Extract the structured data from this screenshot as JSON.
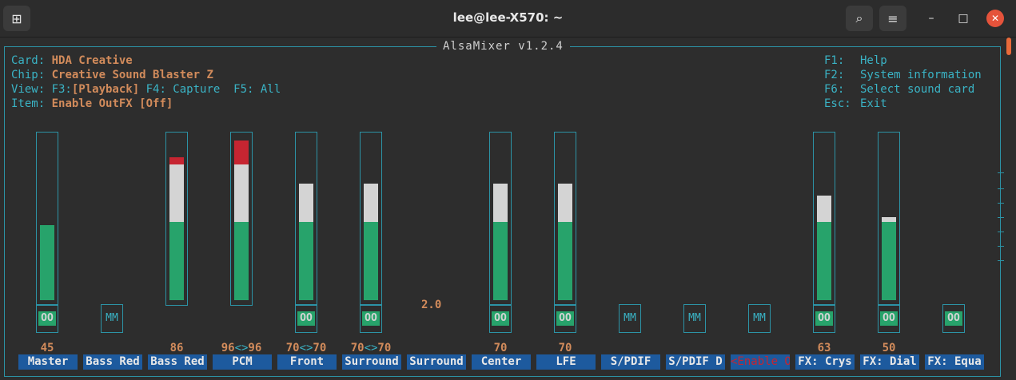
{
  "window": {
    "title": "lee@lee-X570: ~"
  },
  "app": {
    "title": "AlsaMixer v1.2.4"
  },
  "info": {
    "card_label": "Card:",
    "card_value": "HDA Creative",
    "chip_label": "Chip:",
    "chip_value": "Creative Sound Blaster Z",
    "view_label": "View: F3:",
    "view_playback": "[Playback]",
    "view_rest": " F4: Capture  F5: All",
    "item_label": "Item:",
    "item_value": "Enable OutFX [Off]"
  },
  "help": [
    {
      "key": "F1:",
      "desc": "Help"
    },
    {
      "key": "F2:",
      "desc": "System information"
    },
    {
      "key": "F6:",
      "desc": "Select sound card"
    },
    {
      "key": "Esc:",
      "desc": "Exit"
    }
  ],
  "middle_value": "2.0",
  "controls": [
    {
      "name": "Master",
      "label": "45",
      "mute": "OO",
      "level": 45
    },
    {
      "name": "Bass Red",
      "label": "",
      "mute": "MM",
      "level": null
    },
    {
      "name": "Bass Red",
      "label": "86",
      "mute": "",
      "level": 86
    },
    {
      "name": "PCM",
      "label": "96<>96",
      "mute": "",
      "level": 96
    },
    {
      "name": "Front",
      "label": "70<>70",
      "mute": "OO",
      "level": 70
    },
    {
      "name": "Surround",
      "label": "70<>70",
      "mute": "OO",
      "level": 70
    },
    {
      "name": "Surround",
      "label": "",
      "mute": "",
      "level": null
    },
    {
      "name": "Center",
      "label": "70",
      "mute": "OO",
      "level": 70
    },
    {
      "name": "LFE",
      "label": "70",
      "mute": "OO",
      "level": 70
    },
    {
      "name": "S/PDIF",
      "label": "",
      "mute": "MM",
      "level": null
    },
    {
      "name": "S/PDIF D",
      "label": "",
      "mute": "MM",
      "level": null
    },
    {
      "name": "<Enable O>",
      "label": "",
      "mute": "MM",
      "level": null,
      "selected": true
    },
    {
      "name": "FX: Crys",
      "label": "63",
      "mute": "OO",
      "level": 63
    },
    {
      "name": "FX: Dial",
      "label": "50",
      "mute": "OO",
      "level": 50
    },
    {
      "name": "FX: Equa",
      "label": "",
      "mute": "OO",
      "level": null
    }
  ],
  "colors": {
    "accent": "#2c93a6",
    "value": "#d28b5b",
    "level_green": "#27a36b",
    "level_white": "#d4d4d4",
    "level_red": "#c62531",
    "label_bg": "#1d5a9e"
  }
}
